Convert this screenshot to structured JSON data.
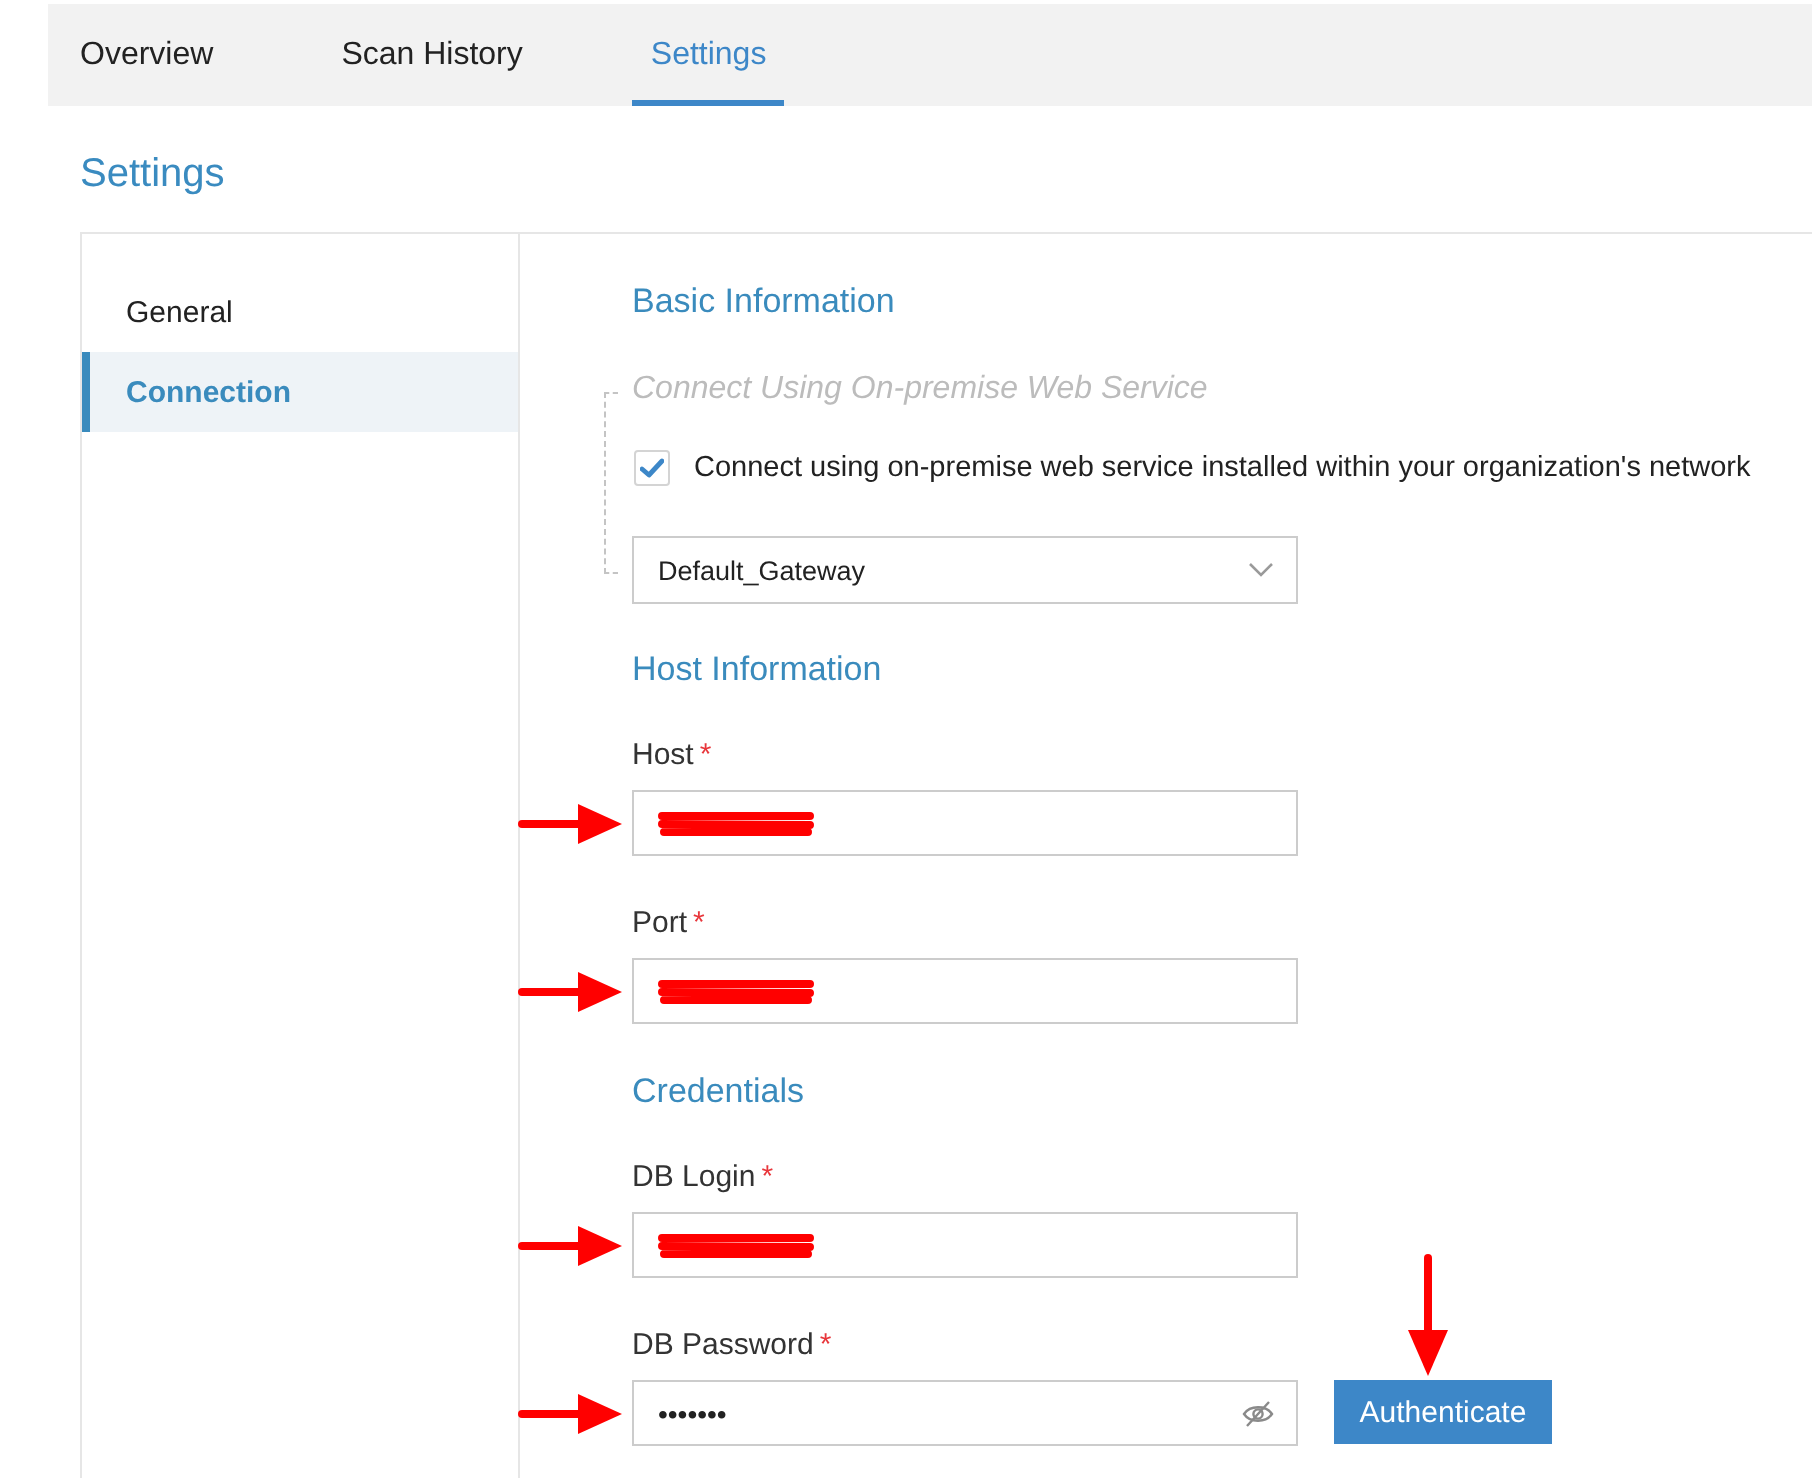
{
  "tabs": [
    {
      "label": "Overview",
      "selected": false
    },
    {
      "label": "Scan History",
      "selected": false
    },
    {
      "label": "Settings",
      "selected": true
    }
  ],
  "page_title": "Settings",
  "sidebar": {
    "items": [
      {
        "label": "General",
        "selected": false
      },
      {
        "label": "Connection",
        "selected": true
      }
    ]
  },
  "basic_information": {
    "title": "Basic Information",
    "legend": "Connect Using On-premise Web Service",
    "checkbox": {
      "label": "Connect using on-premise web service installed within your organization's network",
      "checked": true
    },
    "gateway_dropdown": {
      "value": "Default_Gateway"
    }
  },
  "host_information": {
    "title": "Host Information",
    "fields": [
      {
        "label": "Host",
        "required_mark": "*",
        "kind": "text",
        "redacted": true,
        "annotation_arrow": true
      },
      {
        "label": "Port",
        "required_mark": "*",
        "kind": "text",
        "redacted": true,
        "annotation_arrow": true
      }
    ]
  },
  "credentials": {
    "title": "Credentials",
    "fields": [
      {
        "label": "DB Login",
        "required_mark": "*",
        "kind": "text",
        "redacted": true,
        "annotation_arrow": true
      },
      {
        "label": "DB Password",
        "required_mark": "*",
        "kind": "password",
        "value": "•••••••",
        "redacted": false,
        "annotation_arrow": true
      }
    ],
    "authenticate_button": {
      "label": "Authenticate",
      "annotation_arrow": true
    }
  }
}
